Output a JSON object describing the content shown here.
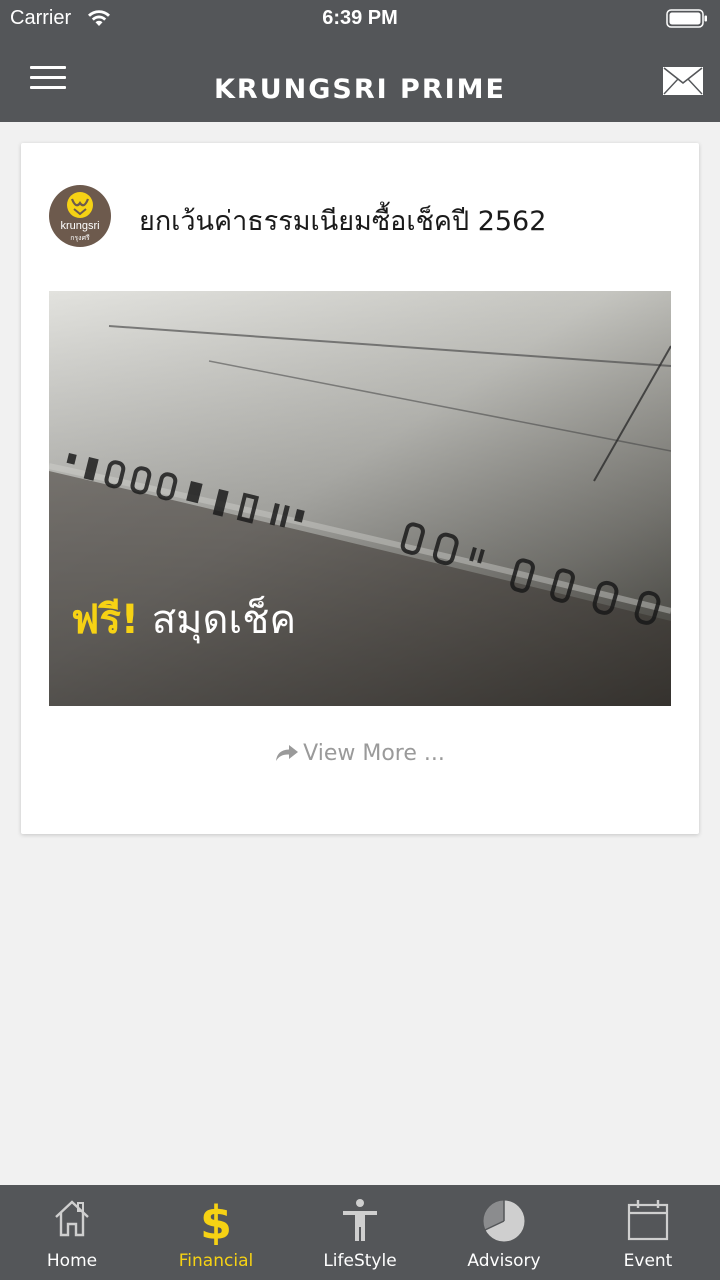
{
  "status_bar": {
    "carrier": "Carrier",
    "time": "6:39 PM"
  },
  "header": {
    "title": "KRUNGSRI PRIME",
    "menu_icon": "hamburger-menu-icon",
    "mail_icon": "envelope-icon"
  },
  "card": {
    "logo_text": "krungsri",
    "logo_subtext": "กรุงศรี",
    "title": "ยกเว้นค่าธรรมเนียมซื้อเช็คปี 2562",
    "image_text_highlight": "ฟรี!",
    "image_text_rest": " สมุดเช็ค",
    "view_more": "View More ..."
  },
  "tabbar": {
    "tabs": [
      {
        "label": "Home",
        "icon": "home-icon"
      },
      {
        "label": "Financial",
        "icon": "dollar-icon"
      },
      {
        "label": "LifeStyle",
        "icon": "person-icon"
      },
      {
        "label": "Advisory",
        "icon": "pie-chart-icon"
      },
      {
        "label": "Event",
        "icon": "calendar-icon"
      }
    ],
    "active_index": 1
  },
  "colors": {
    "header_bg": "#545659",
    "accent_yellow": "#f6d214",
    "page_bg": "#f1f1f1",
    "logo_bg": "#6d5a4d"
  }
}
